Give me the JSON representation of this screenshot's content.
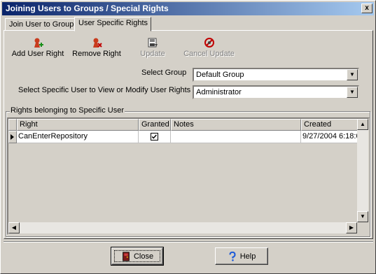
{
  "window": {
    "title": "Joining Users to Groups / Special Rights",
    "close_glyph": "x"
  },
  "tabs": [
    {
      "label": "Join User to Group",
      "active": false
    },
    {
      "label": "User Specific Rights",
      "active": true
    }
  ],
  "toolbar": {
    "add_user_right": {
      "label": "Add User Right",
      "icon": "add-right-icon",
      "enabled": true
    },
    "remove_right": {
      "label": "Remove Right",
      "icon": "remove-right-icon",
      "enabled": true
    },
    "update": {
      "label": "Update",
      "icon": "save-disk-icon",
      "enabled": false
    },
    "cancel_update": {
      "label": "Cancel Update",
      "icon": "cancel-icon",
      "enabled": false
    }
  },
  "form": {
    "select_group_label": "Select Group",
    "select_group_value": "Default Group",
    "select_user_label": "Select Specific User to View or Modify User Rights",
    "select_user_value": "Administrator"
  },
  "rights_group": {
    "label": "Rights belonging to Specific User",
    "columns": [
      "Right",
      "Granted",
      "Notes",
      "Created"
    ],
    "rows": [
      {
        "right": "CanEnterRepository",
        "granted": true,
        "notes": "",
        "created": "9/27/2004 6:18:0"
      }
    ]
  },
  "buttons": {
    "close": {
      "label": "Close",
      "icon": "close-door-icon"
    },
    "help": {
      "label": "Help",
      "icon": "help-question-icon"
    }
  },
  "colors": {
    "title_start": "#0a246a",
    "title_end": "#a6caf0",
    "face": "#d4d0c8",
    "help_icon": "#1e5bd8",
    "right_icon": "#c83c1e"
  }
}
